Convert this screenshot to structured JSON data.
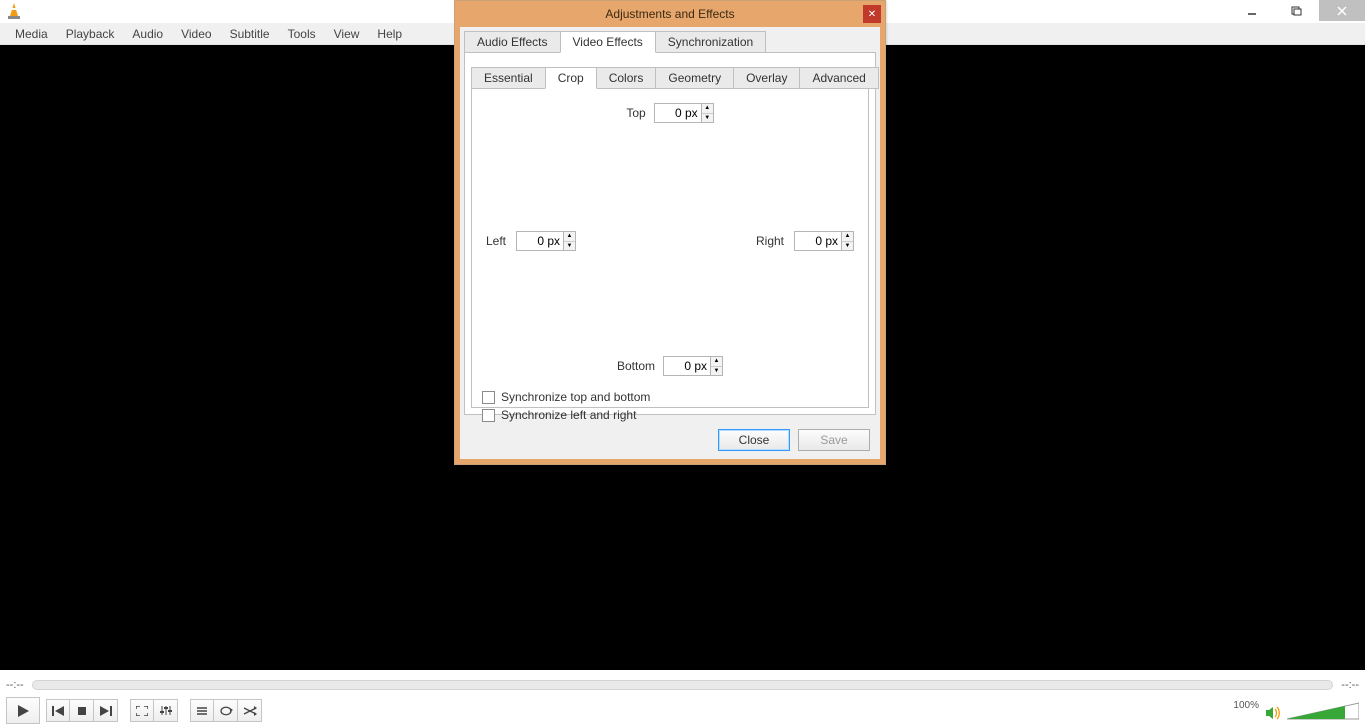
{
  "menubar": [
    "Media",
    "Playback",
    "Audio",
    "Video",
    "Subtitle",
    "Tools",
    "View",
    "Help"
  ],
  "time": {
    "left": "--:--",
    "right": "--:--"
  },
  "volume": {
    "label": "100%"
  },
  "dialog": {
    "title": "Adjustments and Effects",
    "tabs": [
      "Audio Effects",
      "Video Effects",
      "Synchronization"
    ],
    "active_tab": 1,
    "subtabs": [
      "Essential",
      "Crop",
      "Colors",
      "Geometry",
      "Overlay",
      "Advanced"
    ],
    "active_subtab": 1,
    "crop": {
      "top_label": "Top",
      "top_val": "0 px",
      "left_label": "Left",
      "left_val": "0 px",
      "right_label": "Right",
      "right_val": "0 px",
      "bottom_label": "Bottom",
      "bottom_val": "0 px",
      "sync_tb": "Synchronize top and bottom",
      "sync_lr": "Synchronize left and right"
    },
    "buttons": {
      "close": "Close",
      "save": "Save"
    }
  }
}
